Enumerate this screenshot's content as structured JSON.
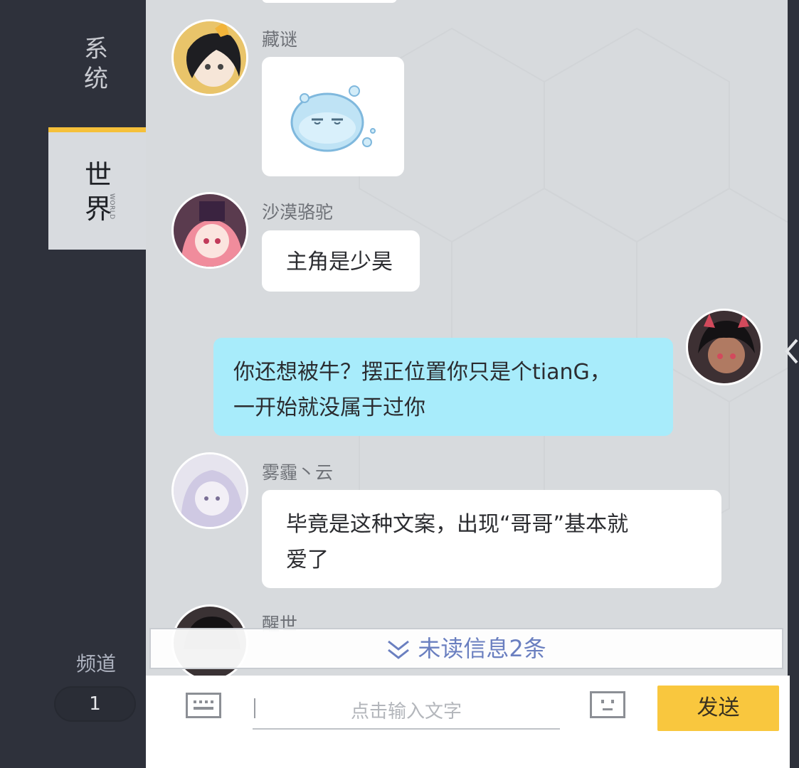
{
  "sidebar": {
    "tab_system": "系统",
    "tab_world": "世界",
    "tab_world_en": "WORLD",
    "channel_label": "频道",
    "channel_value": "1"
  },
  "messages": [
    {
      "user": "藏谜",
      "type": "sticker",
      "sticker": "slime-sticker"
    },
    {
      "user": "沙漠骆驼",
      "type": "text",
      "text": "主角是少昊"
    },
    {
      "user": "",
      "type": "self",
      "text_line1": "你还想被牛？摆正位置你只是个tianG，",
      "text_line2": "一开始就没属于过你"
    },
    {
      "user": "雾霾丶云",
      "type": "text",
      "text_line1": "毕竟是这种文案，出现“哥哥”基本就",
      "text_line2": "爱了"
    },
    {
      "user": "醒世",
      "type": "text"
    }
  ],
  "unread": {
    "label": "未读信息2条"
  },
  "input": {
    "placeholder": "点击输入文字",
    "send_label": "发送"
  },
  "colors": {
    "accent": "#f9c73e",
    "self_bubble": "#a8ecfb",
    "sidebar": "#2e313b"
  },
  "icons": [
    "keyboard-icon",
    "emoji-icon",
    "chevron-down-double-icon",
    "collapse-arrow-icon"
  ]
}
